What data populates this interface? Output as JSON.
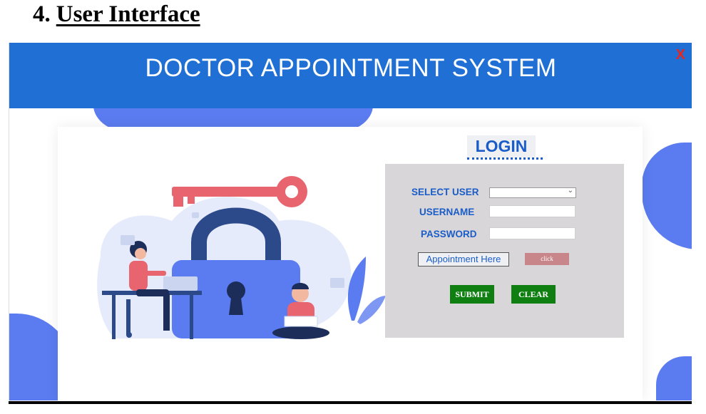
{
  "doc": {
    "section_number": "4.",
    "section_title": "User Interface"
  },
  "app": {
    "title": "DOCTOR APPOINTMENT SYSTEM",
    "close_label": "X"
  },
  "login": {
    "heading": "LOGIN",
    "select_user_label": "SELECT USER",
    "select_user_value": "",
    "username_label": "USERNAME",
    "username_value": "",
    "password_label": "PASSWORD",
    "password_value": "",
    "appointment_link": "Appointment Here",
    "click_button": "click",
    "submit_button": "SUBMIT",
    "clear_button": "CLEAR"
  },
  "colors": {
    "titlebar": "#1f6fd4",
    "accent_text": "#1a5dc8",
    "panel": "#d8d6d8",
    "button_green": "#0f7f12",
    "click_button": "#c9868a",
    "close": "#e8261d",
    "illustration_blue": "#5b7cf0"
  },
  "icons": {
    "illustration": "security-login-illustration",
    "key": "key-icon",
    "lock": "padlock-icon"
  }
}
